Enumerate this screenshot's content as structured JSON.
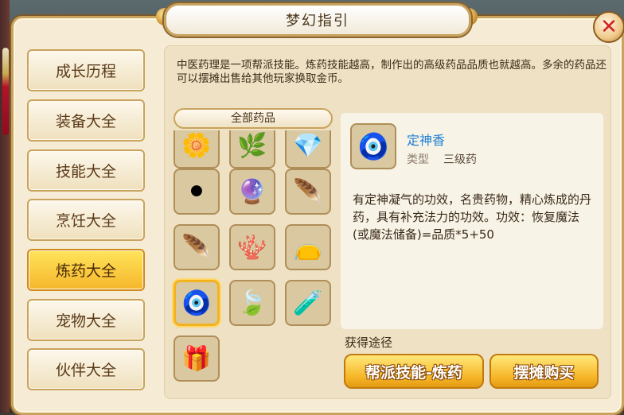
{
  "window": {
    "title": "梦幻指引"
  },
  "nav": {
    "items": [
      {
        "label": "成长历程",
        "active": false
      },
      {
        "label": "装备大全",
        "active": false
      },
      {
        "label": "技能大全",
        "active": false
      },
      {
        "label": "烹饪大全",
        "active": false
      },
      {
        "label": "炼药大全",
        "active": true
      },
      {
        "label": "宠物大全",
        "active": false
      },
      {
        "label": "伙伴大全",
        "active": false
      }
    ]
  },
  "intro": "中医药理是一项帮派技能。炼药技能越高，制作出的高级药品品质也就越高。多余的药品还可以摆摊出售给其他玩家换取金币。",
  "category": {
    "label": "全部药品"
  },
  "items": [
    {
      "icon": "flower-herb-icon",
      "glyph": "🌼"
    },
    {
      "icon": "yellow-root-icon",
      "glyph": "🌿"
    },
    {
      "icon": "crystal-leaf-icon",
      "glyph": "💎"
    },
    {
      "icon": "black-pill-icon",
      "glyph": "⚫"
    },
    {
      "icon": "pink-orb-icon",
      "glyph": "🔮"
    },
    {
      "icon": "peacock-feather-icon",
      "glyph": "🪶"
    },
    {
      "icon": "red-feather-icon",
      "glyph": "🪶"
    },
    {
      "icon": "pink-coral-icon",
      "glyph": "🪸"
    },
    {
      "icon": "red-pouch-icon",
      "glyph": "👝"
    },
    {
      "icon": "incense-pot-icon",
      "glyph": "🧿"
    },
    {
      "icon": "green-leaf-beads-icon",
      "glyph": "🍃"
    },
    {
      "icon": "blue-potion-icon",
      "glyph": "🧪"
    },
    {
      "icon": "open-box-icon",
      "glyph": "🎁"
    }
  ],
  "selected_index": 9,
  "detail": {
    "icon": "incense-pot-icon",
    "glyph": "🧿",
    "name": "定神香",
    "type_label": "类型",
    "type_value": "三级药",
    "description": "有定神凝气的功效，名贵药物，精心炼成的丹药，具有补充法力的功效。功效：恢复魔法(或魔法储备)=品质*5+50",
    "obtain_label": "获得途径",
    "obtain_buttons": [
      "帮派技能-炼药",
      "摆摊购买"
    ]
  },
  "colors": {
    "accent": "#f5b62c",
    "name": "#1f7fd3",
    "frame": "#c9a35e"
  }
}
